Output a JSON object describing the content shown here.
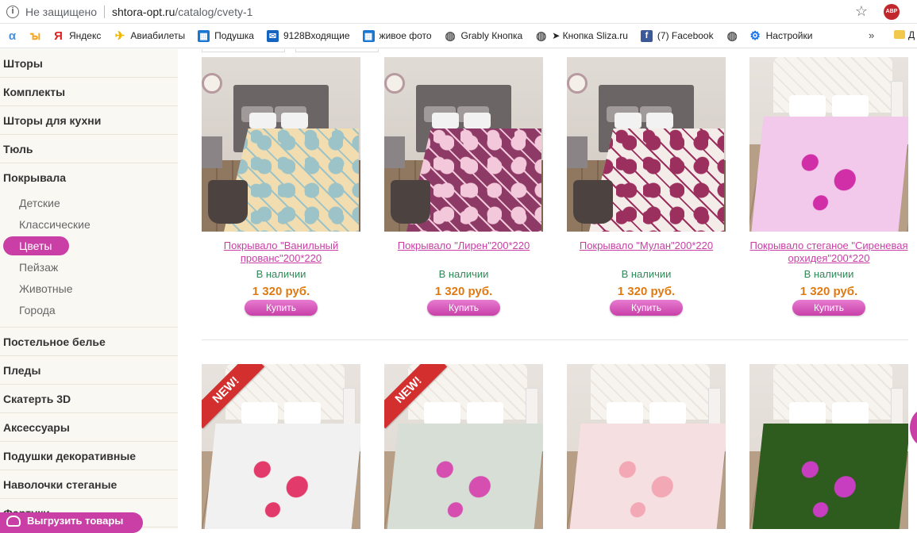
{
  "address_bar": {
    "security": "Не защищено",
    "url_host": "shtora-opt.ru",
    "url_path": "/catalog/cvety-1",
    "adblock_label": "ABP"
  },
  "bookmarks": [
    {
      "icon": "a",
      "label": "",
      "color": "#4a90d9"
    },
    {
      "icon": "g",
      "label": "",
      "color": "#f5a623"
    },
    {
      "icon": "Я",
      "label": "Яндекс",
      "color": "#e02020"
    },
    {
      "icon": "plane",
      "label": "Авиабилеты",
      "color": "#f2b600"
    },
    {
      "icon": "squares",
      "label": "Подушка",
      "color": "#1976d2"
    },
    {
      "icon": "mail",
      "label": "9128Входящие",
      "color": "#1565c0"
    },
    {
      "icon": "squares",
      "label": "живое фото",
      "color": "#1976d2"
    },
    {
      "icon": "globe",
      "label": "Grably Кнопка",
      "color": "#555555"
    },
    {
      "icon": "globe",
      "label": "➤ Кнопка Sliza.ru",
      "color": "#555555"
    },
    {
      "icon": "f",
      "label": "(7) Facebook",
      "color": "#3b5998"
    },
    {
      "icon": "globe",
      "label": "",
      "color": "#555555"
    },
    {
      "icon": "gear",
      "label": "Настройки",
      "color": "#1a73e8"
    }
  ],
  "bookmarks_overflow": "»",
  "bookmarks_tail": "Д",
  "sidebar": {
    "top_categories": [
      "Шторы",
      "Комплекты",
      "Шторы для кухни",
      "Тюль",
      "Покрывала"
    ],
    "subcategories": [
      "Детские",
      "Классические",
      "Цветы",
      "Пейзаж",
      "Животные",
      "Города"
    ],
    "active_sub": "Цветы",
    "bottom_categories": [
      "Постельное белье",
      "Пледы",
      "Скатерть 3D",
      "Аксессуары",
      "Подушки декоративные",
      "Наволочки стеганые",
      "Фартуки"
    ]
  },
  "products_row1": [
    {
      "title": "Покрывало \"Ванильный прованс\"200*220",
      "stock": "В наличии",
      "price": "1 320 руб.",
      "buy": "Купить",
      "duvet_color": "#f1ddb0",
      "duvet_accent": "#9cc3c7"
    },
    {
      "title": "Покрывало \"Лирен\"200*220",
      "stock": "В наличии",
      "price": "1 320 руб.",
      "buy": "Купить",
      "duvet_color": "#8e3a66",
      "duvet_accent": "#f2c8da"
    },
    {
      "title": "Покрывало \"Мулан\"200*220",
      "stock": "В наличии",
      "price": "1 320 руб.",
      "buy": "Купить",
      "duvet_color": "#f4ece9",
      "duvet_accent": "#9b2f5e"
    },
    {
      "title": "Покрывало стеганое \"Сиреневая орхидея\"200*220",
      "stock": "В наличии",
      "price": "1 320 руб.",
      "buy": "Купить",
      "duvet_color": "#f2c9ea",
      "duvet_accent": "#d02fa8"
    }
  ],
  "products_row2": [
    {
      "badge": "NEW!",
      "duvet_color": "#f1f1f1",
      "duvet_accent": "#e23a6a"
    },
    {
      "badge": "NEW!",
      "duvet_color": "#d6ded5",
      "duvet_accent": "#d64fb0"
    },
    {
      "badge": "",
      "duvet_color": "#f6dfe1",
      "duvet_accent": "#f3a8b6"
    },
    {
      "badge": "",
      "duvet_color": "#2e5b1e",
      "duvet_accent": "#c73ec0"
    }
  ],
  "upload_button": "Выгрузить товары"
}
